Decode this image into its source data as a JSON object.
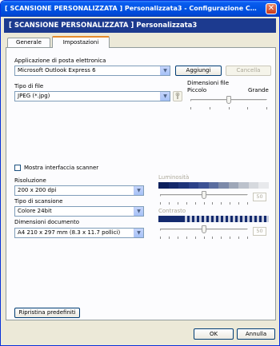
{
  "window": {
    "title": "[ SCANSIONE PERSONALIZZATA ] Personalizzata3 - Configurazione Contro...",
    "close_glyph": "✕"
  },
  "header": {
    "title": "[ SCANSIONE PERSONALIZZATA ]   Personalizzata3"
  },
  "tabs": [
    {
      "label": "Generale",
      "active": false
    },
    {
      "label": "Impostazioni",
      "active": true
    }
  ],
  "email": {
    "label": "Applicazione di posta elettronica",
    "value": "Microsoft Outlook Express 6",
    "add_label": "Aggiungi",
    "delete_label": "Cancella"
  },
  "filetype": {
    "label": "Tipo di file",
    "value": "JPEG (*.jpg)"
  },
  "filesize": {
    "label": "Dimensioni file",
    "min_label": "Piccolo",
    "max_label": "Grande",
    "level": 0.5
  },
  "scanner_ui": {
    "label": "Mostra interfaccia scanner",
    "checked": false
  },
  "resolution": {
    "label": "Risoluzione",
    "value": "200 x 200 dpi"
  },
  "scan_type": {
    "label": "Tipo di scansione",
    "value": "Colore 24bit"
  },
  "doc_size": {
    "label": "Dimensioni documento",
    "value": "A4 210 x 297 mm (8.3 x 11.7 pollici)"
  },
  "brightness": {
    "label": "Luminosità",
    "value": "50",
    "level": 0.5
  },
  "contrast": {
    "label": "Contrasto",
    "value": "50",
    "level": 0.5
  },
  "footer": {
    "reset_label": "Ripristina predefiniti",
    "ok_label": "OK",
    "cancel_label": "Annulla"
  },
  "colors": {
    "titlebar": "#0054e3",
    "header_band": "#1c3a8f",
    "tab_accent": "#e68b2c",
    "window_bg": "#ece9d8"
  },
  "icons": {
    "combo_arrow": "▼",
    "file_settings": "wrench-icon"
  }
}
